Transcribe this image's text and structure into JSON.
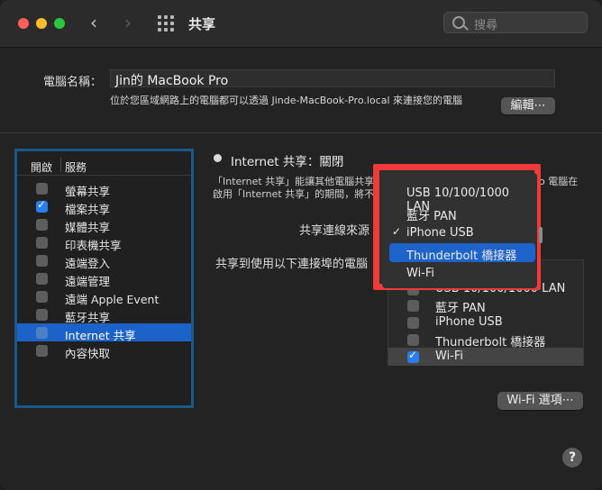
{
  "window": {
    "title": "共享",
    "search_placeholder": "搜尋"
  },
  "nav": {
    "back": "‹",
    "forward": "›"
  },
  "computer_name": {
    "label": "電腦名稱：",
    "value": "Jin的 MacBook Pro",
    "description": "位於您區域網路上的電腦都可以透過 Jinde-MacBook-Pro.local 來連接您的電腦",
    "edit_button": "編輯⋯"
  },
  "services": {
    "col_on": "開啟",
    "col_service": "服務",
    "items": [
      {
        "label": "螢幕共享",
        "checked": false
      },
      {
        "label": "檔案共享",
        "checked": true
      },
      {
        "label": "媒體共享",
        "checked": false
      },
      {
        "label": "印表機共享",
        "checked": false
      },
      {
        "label": "遠端登入",
        "checked": false
      },
      {
        "label": "遠端管理",
        "checked": false
      },
      {
        "label": "遠端 Apple Event",
        "checked": false
      },
      {
        "label": "藍牙共享",
        "checked": false
      },
      {
        "label": "Internet 共享",
        "checked": false,
        "selected": true
      },
      {
        "label": "內容快取",
        "checked": false
      }
    ]
  },
  "internet_sharing": {
    "status": "Internet 共享：關閉",
    "desc_line1_left": "「Internet 共享」能讓其他電腦共享",
    "desc_line1_right": "o 電腦在",
    "desc_line2": "啟用「Internet 共享」的期間，將不",
    "share_from_label": "共享連線來源",
    "to_computers_label": "共享到使用以下連接埠的電腦",
    "ports": [
      {
        "label": "USB 10/100/1000 LAN",
        "checked": false
      },
      {
        "label": "藍牙 PAN",
        "checked": false
      },
      {
        "label": "iPhone USB",
        "checked": false
      },
      {
        "label": "Thunderbolt 橋接器",
        "checked": false
      },
      {
        "label": "Wi-Fi",
        "checked": true
      }
    ],
    "wifi_options_button": "Wi-Fi 選項⋯"
  },
  "popup_menu": {
    "checkmark": "✓",
    "items": [
      {
        "label": "USB 10/100/1000 LAN"
      },
      {
        "label": "藍牙 PAN"
      },
      {
        "label": "iPhone USB",
        "checked": true
      },
      {
        "label": "Thunderbolt 橋接器",
        "highlighted": true
      },
      {
        "label": "Wi-Fi"
      }
    ]
  },
  "help": "?",
  "colors": {
    "highlight": "#1d63c9",
    "annotation": "#ef3a3a",
    "panel_border": "#1a5a8a"
  }
}
